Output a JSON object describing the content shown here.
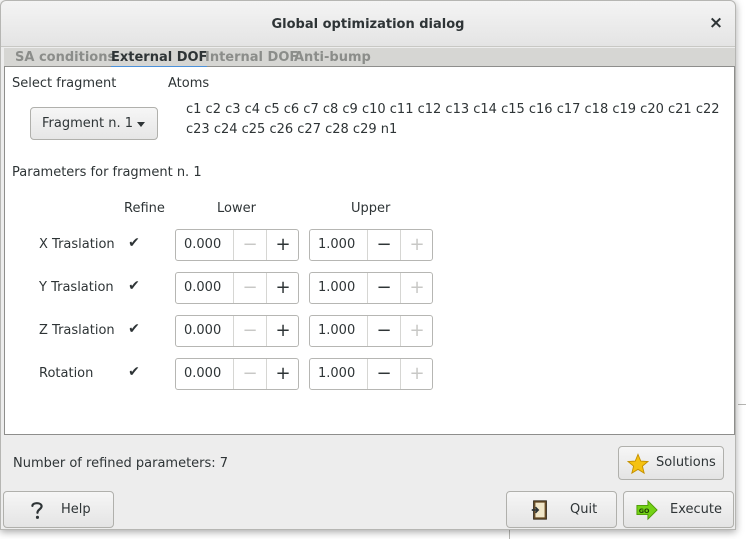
{
  "window": {
    "title": "Global optimization dialog",
    "close_symbol": "×"
  },
  "tabs": [
    {
      "label": "SA conditions",
      "active": false
    },
    {
      "label": "External DOF",
      "active": true
    },
    {
      "label": "Internal DOF",
      "active": false
    },
    {
      "label": "Anti-bump",
      "active": false
    }
  ],
  "fragment": {
    "select_label": "Select fragment",
    "atoms_label": "Atoms",
    "selected": "Fragment n. 1",
    "atoms": "c1 c2 c3 c4 c5 c6 c7 c8 c9 c10 c11 c12 c13 c14 c15 c16 c17 c18 c19 c20 c21 c22 c23 c24 c25 c26 c27 c28 c29 n1"
  },
  "params": {
    "title": "Parameters for fragment n. 1",
    "headers": {
      "refine": "Refine",
      "lower": "Lower",
      "upper": "Upper"
    },
    "rows": [
      {
        "name": "X Traslation",
        "refine": true,
        "lower": "0.000",
        "upper": "1.000"
      },
      {
        "name": "Y Traslation",
        "refine": true,
        "lower": "0.000",
        "upper": "1.000"
      },
      {
        "name": "Z Traslation",
        "refine": true,
        "lower": "0.000",
        "upper": "1.000"
      },
      {
        "name": "Rotation",
        "refine": true,
        "lower": "0.000",
        "upper": "1.000"
      }
    ]
  },
  "footer": {
    "refined_count": "Number of refined parameters: 7",
    "solutions_label": "Solutions",
    "help_label": "Help",
    "quit_label": "Quit",
    "execute_label": "Execute"
  },
  "icons": {
    "check": "✔",
    "minus": "−",
    "plus": "+",
    "solutions": "star-icon",
    "help": "question-icon",
    "quit": "exit-door-icon",
    "execute": "go-arrow-icon"
  },
  "colors": {
    "accent": "#4a90d9",
    "star": "#f5c211",
    "go_green": "#4e9a06"
  }
}
